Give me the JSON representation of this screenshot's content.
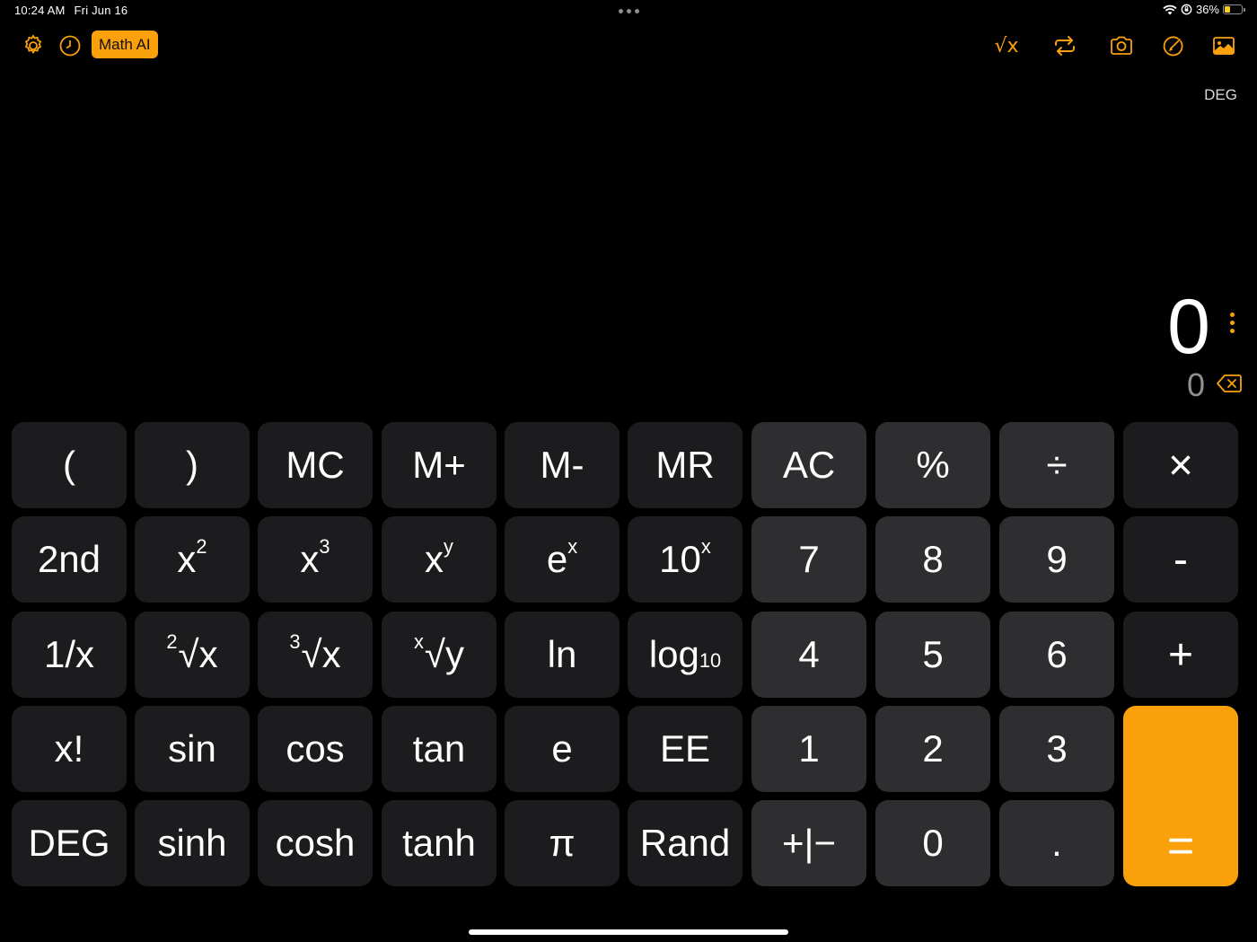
{
  "status_bar": {
    "time": "10:24 AM",
    "date": "Fri Jun 16",
    "battery": "36%",
    "battery_level": 0.36
  },
  "toolbar": {
    "settings_icon": "gear-icon",
    "history_icon": "clock-icon",
    "math_ai_label": "Math AI",
    "sqrt_label": "√x",
    "convert_icon": "repeat-icon",
    "camera_icon": "camera-icon",
    "markup_icon": "pencil-circle-icon",
    "photo_icon": "photo-icon"
  },
  "mode": "DEG",
  "display": {
    "value": "0",
    "preview": "0"
  },
  "keys": {
    "open_paren": "(",
    "close_paren": ")",
    "mc": "MC",
    "mplus": "M+",
    "mminus": "M-",
    "mr": "MR",
    "ac": "AC",
    "percent": "%",
    "divide": "÷",
    "multiply": "×",
    "second": "2nd",
    "x_base": "x",
    "exp_2": "2",
    "exp_3": "3",
    "exp_y": "y",
    "e_base": "e",
    "exp_x": "x",
    "ten_base": "10",
    "seven": "7",
    "eight": "8",
    "nine": "9",
    "minus": "-",
    "reciprocal": "1/x",
    "root_sym": "√x",
    "root_sym_y": "√y",
    "root_2_idx": "2",
    "root_3_idx": "3",
    "root_x_idx": "x",
    "ln": "ln",
    "log_base": "log",
    "log_sub": "10",
    "four": "4",
    "five": "5",
    "six": "6",
    "plus": "+",
    "factorial": "x!",
    "sin": "sin",
    "cos": "cos",
    "tan": "tan",
    "e": "e",
    "ee": "EE",
    "one": "1",
    "two": "2",
    "three": "3",
    "deg": "DEG",
    "sinh": "sinh",
    "cosh": "cosh",
    "tanh": "tanh",
    "pi": "π",
    "rand": "Rand",
    "sign": "+|−",
    "zero": "0",
    "decimal": ".",
    "equals": "="
  },
  "colors": {
    "accent": "#f9a00b",
    "function_key": "#1c1c1e",
    "number_key": "#2e2e30",
    "background": "#000000"
  }
}
